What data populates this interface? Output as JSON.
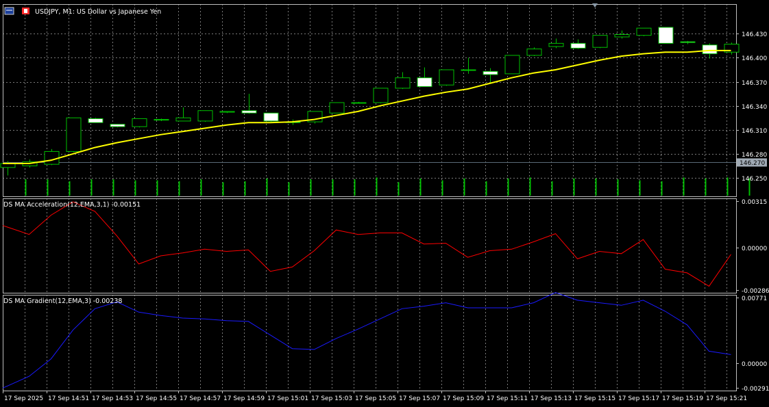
{
  "header": {
    "symbol_title": "USDJPY, M1:  US Dollar vs  Japanese Yen"
  },
  "colors": {
    "background": "#000000",
    "grid": "#7a7a7a",
    "frame": "#c0c0c0",
    "text": "#ffffff",
    "candle_outline": "#00c000",
    "bull_fill": "#000000",
    "bear_fill": "#ffffff",
    "ma_line": "#ffff00",
    "volume": "#00c000",
    "bid_line": "#5a6b78",
    "price_tag_bg": "#a0aab4",
    "acceleration_line": "#ff0000",
    "gradient_line": "#1a1aff"
  },
  "chart_data": [
    {
      "type": "candlestick",
      "panel": "main",
      "current_price_label": "146.270",
      "current_price": 146.27,
      "ylim": [
        146.227,
        146.467
      ],
      "y_ticks": [
        "146.430",
        "146.400",
        "146.370",
        "146.340",
        "146.310",
        "146.280",
        "146.250"
      ],
      "y_tick_values": [
        146.43,
        146.4,
        146.37,
        146.34,
        146.31,
        146.28,
        146.25
      ],
      "candles": [
        {
          "o": 146.263,
          "h": 146.271,
          "l": 146.253,
          "c": 146.268
        },
        {
          "o": 146.265,
          "h": 146.273,
          "l": 146.263,
          "c": 146.27
        },
        {
          "o": 146.267,
          "h": 146.286,
          "l": 146.266,
          "c": 146.283
        },
        {
          "o": 146.283,
          "h": 146.325,
          "l": 146.282,
          "c": 146.325
        },
        {
          "o": 146.324,
          "h": 146.325,
          "l": 146.319,
          "c": 146.319
        },
        {
          "o": 146.317,
          "h": 146.317,
          "l": 146.313,
          "c": 146.314
        },
        {
          "o": 146.314,
          "h": 146.324,
          "l": 146.313,
          "c": 146.324
        },
        {
          "o": 146.323,
          "h": 146.324,
          "l": 146.321,
          "c": 146.323
        },
        {
          "o": 146.321,
          "h": 146.338,
          "l": 146.321,
          "c": 146.325
        },
        {
          "o": 146.321,
          "h": 146.334,
          "l": 146.32,
          "c": 146.334
        },
        {
          "o": 146.332,
          "h": 146.333,
          "l": 146.331,
          "c": 146.333
        },
        {
          "o": 146.334,
          "h": 146.355,
          "l": 146.33,
          "c": 146.331
        },
        {
          "o": 146.331,
          "h": 146.331,
          "l": 146.32,
          "c": 146.321
        },
        {
          "o": 146.32,
          "h": 146.323,
          "l": 146.316,
          "c": 146.319
        },
        {
          "o": 146.32,
          "h": 146.333,
          "l": 146.318,
          "c": 146.333
        },
        {
          "o": 146.331,
          "h": 146.344,
          "l": 146.331,
          "c": 146.344
        },
        {
          "o": 146.344,
          "h": 146.345,
          "l": 146.343,
          "c": 146.344
        },
        {
          "o": 146.344,
          "h": 146.362,
          "l": 146.343,
          "c": 146.362
        },
        {
          "o": 146.362,
          "h": 146.382,
          "l": 146.361,
          "c": 146.375
        },
        {
          "o": 146.375,
          "h": 146.388,
          "l": 146.364,
          "c": 146.364
        },
        {
          "o": 146.366,
          "h": 146.385,
          "l": 146.365,
          "c": 146.385
        },
        {
          "o": 146.385,
          "h": 146.4,
          "l": 146.38,
          "c": 146.385
        },
        {
          "o": 146.383,
          "h": 146.387,
          "l": 146.369,
          "c": 146.379
        },
        {
          "o": 146.38,
          "h": 146.403,
          "l": 146.38,
          "c": 146.403
        },
        {
          "o": 146.403,
          "h": 146.413,
          "l": 146.402,
          "c": 146.411
        },
        {
          "o": 146.414,
          "h": 146.424,
          "l": 146.412,
          "c": 146.418
        },
        {
          "o": 146.418,
          "h": 146.423,
          "l": 146.411,
          "c": 146.412
        },
        {
          "o": 146.413,
          "h": 146.428,
          "l": 146.412,
          "c": 146.428
        },
        {
          "o": 146.426,
          "h": 146.434,
          "l": 146.424,
          "c": 146.429
        },
        {
          "o": 146.428,
          "h": 146.437,
          "l": 146.427,
          "c": 146.437
        },
        {
          "o": 146.438,
          "h": 146.438,
          "l": 146.418,
          "c": 146.418
        },
        {
          "o": 146.42,
          "h": 146.421,
          "l": 146.417,
          "c": 146.419
        },
        {
          "o": 146.416,
          "h": 146.418,
          "l": 146.399,
          "c": 146.405
        },
        {
          "o": 146.407,
          "h": 146.419,
          "l": 146.404,
          "c": 146.417
        }
      ],
      "ma_values": [
        146.268,
        146.268,
        146.272,
        146.28,
        146.288,
        146.294,
        146.299,
        146.304,
        146.308,
        146.312,
        146.316,
        146.319,
        146.319,
        146.32,
        146.323,
        146.328,
        146.333,
        146.34,
        146.346,
        146.352,
        146.357,
        146.361,
        146.368,
        146.375,
        146.381,
        146.385,
        146.391,
        146.397,
        146.402,
        146.405,
        146.407,
        146.407,
        146.409,
        146.409
      ],
      "volumes": [
        0.85,
        0.85,
        0.75,
        0.85,
        0.85,
        0.8,
        0.8,
        0.75,
        0.85,
        0.7,
        0.75,
        0.9,
        0.7,
        0.85,
        0.85,
        0.85,
        0.95,
        0.7,
        0.9,
        0.8,
        0.9,
        0.75,
        0.9,
        0.95,
        0.75,
        0.9,
        0.9,
        0.85,
        0.8,
        0.75,
        0.95,
        0.9,
        0.95,
        0.9
      ]
    },
    {
      "type": "line",
      "panel": "indicator-1",
      "title": "DS MA Acceleration(12,EMA,3,1) -0.00151",
      "ylim": [
        -0.00286,
        0.00315
      ],
      "y_ticks": [
        "0.00315",
        "0.00000",
        "-0.00286"
      ],
      "y_tick_values": [
        0.00315,
        0.0,
        -0.00286
      ],
      "values": [
        0.0014,
        0.0009,
        0.0022,
        0.0031,
        0.00245,
        0.0008,
        -0.0011,
        -0.00055,
        -0.00035,
        -0.0001,
        -0.00025,
        -0.00015,
        -0.0016,
        -0.0013,
        -0.0002,
        0.0012,
        0.0009,
        0.001,
        0.001,
        0.00025,
        0.0003,
        -0.00065,
        -0.0002,
        -0.0001,
        0.0004,
        0.00095,
        -0.00075,
        -0.00025,
        -0.0004,
        0.00055,
        -0.00145,
        -0.0017,
        -0.0026,
        -0.00045
      ]
    },
    {
      "type": "line",
      "panel": "indicator-2",
      "title": "DS MA Gradient(12,EMA,3) -0.00238",
      "ylim": [
        -0.00291,
        0.00771
      ],
      "y_ticks": [
        "0.00771",
        "0.00000",
        "-0.00291"
      ],
      "y_tick_values": [
        0.00771,
        0.0,
        -0.00291
      ],
      "values": [
        -0.0027,
        -0.00155,
        0.0005,
        0.0039,
        0.0064,
        0.0072,
        0.006,
        0.0056,
        0.0053,
        0.0052,
        0.005,
        0.0049,
        0.0033,
        0.0017,
        0.0016,
        0.0029,
        0.004,
        0.0052,
        0.0064,
        0.0067,
        0.0071,
        0.0065,
        0.0065,
        0.0065,
        0.0071,
        0.0083,
        0.0074,
        0.0071,
        0.0068,
        0.0074,
        0.0061,
        0.0045,
        0.0014,
        0.001
      ]
    }
  ],
  "x_axis": {
    "labels": [
      "17 Sep 2025",
      "17 Sep 14:51",
      "17 Sep 14:53",
      "17 Sep 14:55",
      "17 Sep 14:57",
      "17 Sep 14:59",
      "17 Sep 15:01",
      "17 Sep 15:03",
      "17 Sep 15:05",
      "17 Sep 15:07",
      "17 Sep 15:09",
      "17 Sep 15:11",
      "17 Sep 15:13",
      "17 Sep 15:15",
      "17 Sep 15:17",
      "17 Sep 15:19",
      "17 Sep 15:21"
    ]
  }
}
